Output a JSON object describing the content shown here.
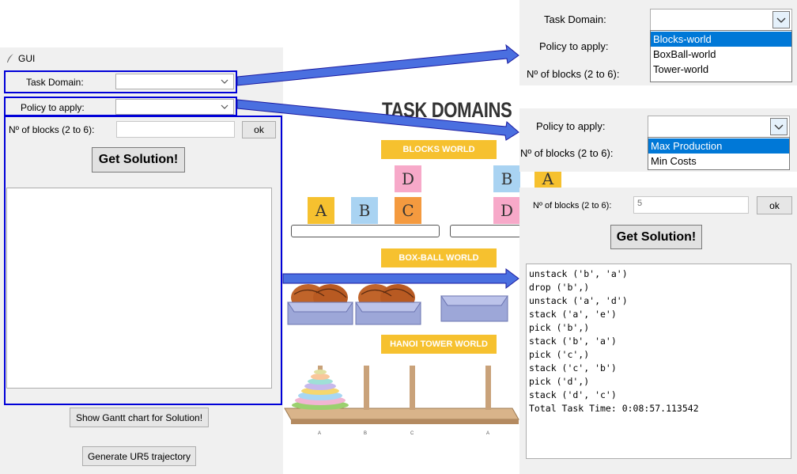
{
  "gui": {
    "title": "GUI",
    "task_domain_label": "Task Domain:",
    "policy_label": "Policy to apply:",
    "nblocks_label": "Nº of blocks (2 to 6):",
    "ok_label": "ok",
    "get_solution_label": "Get Solution!",
    "gantt_button": "Show Gantt chart for Solution!",
    "ur5_button": "Generate UR5 trajectory"
  },
  "illustration": {
    "title": "TASK DOMAINS",
    "blocks_world": "BLOCKS WORLD",
    "boxball_world": "BOX-BALL WORLD",
    "hanoi_world": "HANOI TOWER WORLD",
    "block_letters": [
      "A",
      "B",
      "D",
      "C",
      "B",
      "D",
      "A"
    ],
    "peg_letters": [
      "A",
      "B",
      "C",
      "A"
    ]
  },
  "task_domain_zoom": {
    "label": "Task Domain:",
    "policy_label": "Policy to apply:",
    "nblocks_label": "Nº of blocks (2 to 6):",
    "options": [
      "Blocks-world",
      "BoxBall-world",
      "Tower-world"
    ],
    "selected_index": 0
  },
  "policy_zoom": {
    "label": "Policy to apply:",
    "nblocks_label": "Nº of blocks (2 to 6):",
    "options": [
      "Max Production",
      "Min Costs"
    ],
    "selected_index": 0
  },
  "result_zoom": {
    "nblocks_label": "Nº of blocks (2 to 6):",
    "nblocks_value": "5",
    "ok_label": "ok",
    "get_solution_label": "Get Solution!",
    "output_lines": [
      "unstack ('b', 'a')",
      "drop ('b',)",
      "unstack ('a', 'd')",
      "stack ('a', 'e')",
      "pick ('b',)",
      "stack ('b', 'a')",
      "pick ('c',)",
      "stack ('c', 'b')",
      "pick ('d',)",
      "stack ('d', 'c')",
      "Total Task Time: 0:08:57.113542"
    ]
  },
  "colors": {
    "highlight": "#0000d8",
    "banner": "#f6c12f",
    "selection": "#0078d7"
  }
}
